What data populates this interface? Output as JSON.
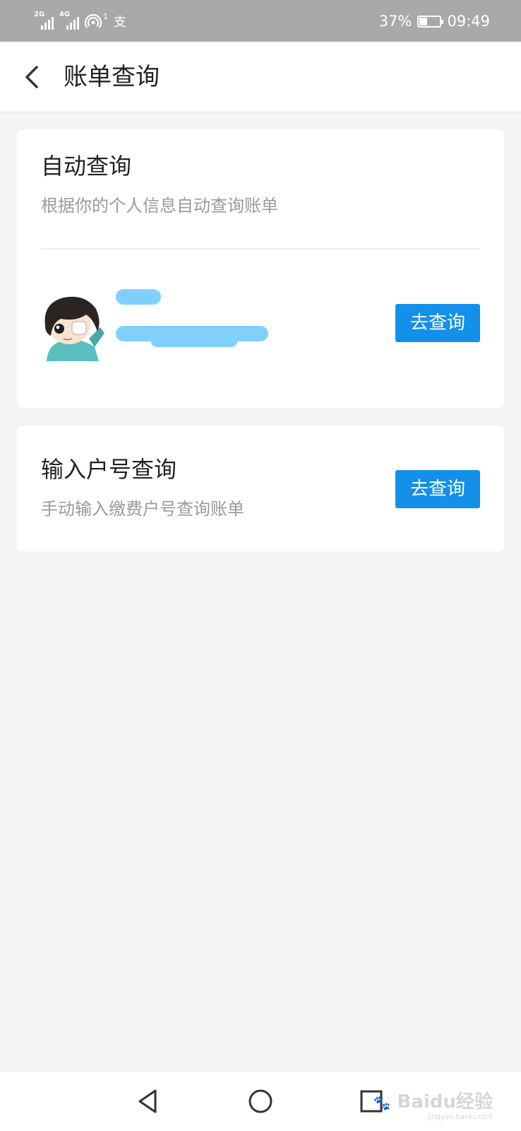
{
  "status_bar": {
    "signal1_tag": "2G",
    "signal2_tag": "4G",
    "wifi_badge": "1",
    "pay_icon": "支",
    "battery_percent": "37%",
    "battery_level": 0.37,
    "time": "09:49"
  },
  "header": {
    "title": "账单查询"
  },
  "auto_query": {
    "title": "自动查询",
    "subtitle": "根据你的个人信息自动查询账单",
    "query_button": "去查询"
  },
  "manual_query": {
    "title": "输入户号查询",
    "subtitle": "手动输入缴费户号查询账单",
    "query_button": "去查询"
  },
  "watermark": {
    "brand": "Baidu经验",
    "site": "jingyan.baidu.com"
  },
  "colors": {
    "accent": "#1390e8",
    "redaction": "#80d0ff",
    "status_bar": "#a9a9a9"
  }
}
